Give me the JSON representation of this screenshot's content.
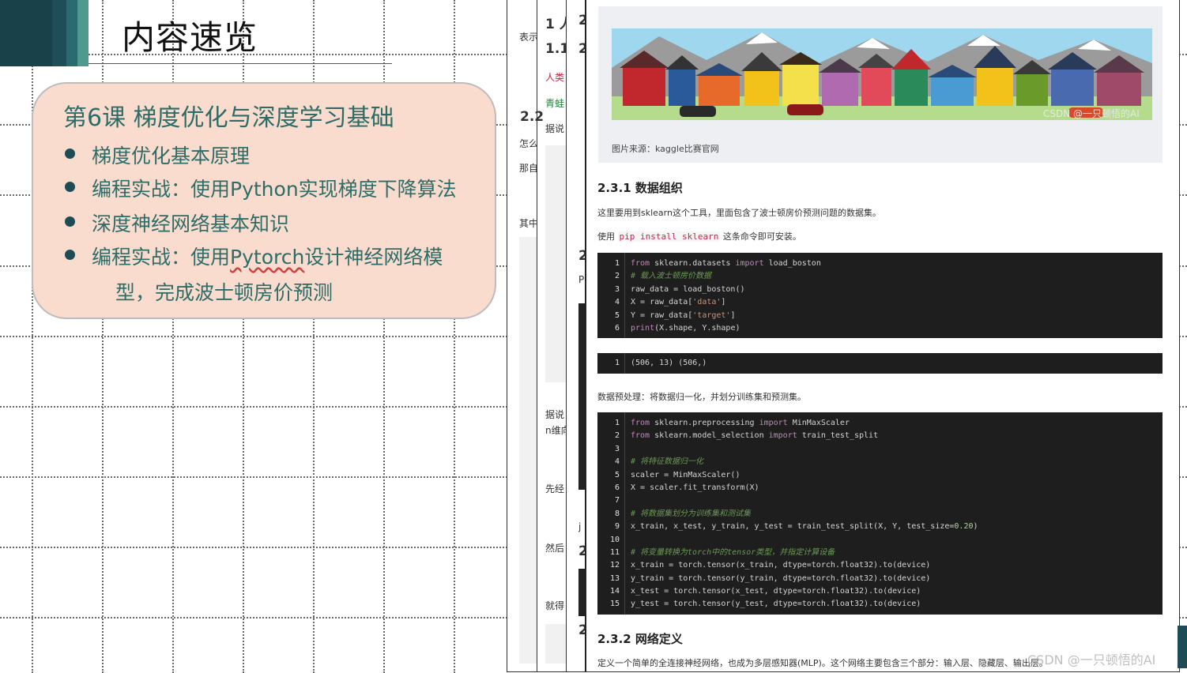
{
  "slide": {
    "title": "内容速览",
    "lesson_title": "第6课 梯度优化与深度学习基础",
    "items": [
      "梯度优化基本原理",
      "编程实战：使用Python实现梯度下降算法",
      "深度神经网络基本知识",
      "编程实战：使用Pytorch设计神经网络模",
      "型，完成波士顿房价预测"
    ],
    "pytorch_word": "Pytorch"
  },
  "bg_pages": {
    "p1": [
      "表示",
      "怎么",
      "那自",
      "其中"
    ],
    "p2": [
      "1 人",
      "1.1",
      "人类",
      "青蛙",
      "2.2",
      "据说",
      "据说",
      "n维向",
      "先经",
      "然后",
      "就得"
    ],
    "p3": [
      "2",
      "2",
      "2",
      "P",
      "2",
      "j",
      "2"
    ]
  },
  "doc": {
    "image_caption": "图片来源：kaggle比赛官网",
    "image_watermark": "CSDN @一只顿悟的AI",
    "h_data_org": "2.3.1 数据组织",
    "p_sklearn": "这里要用到sklearn这个工具，里面包含了波士顿房价预测问题的数据集。",
    "p_install_pre": "使用",
    "p_install_code": "pip install sklearn",
    "p_install_post": "这条命令即可安装。",
    "p_preprocess": "数据预处理：将数据归一化，并划分训练集和预测集。",
    "h_net_def": "2.3.2 网络定义",
    "p_net": "定义一个简单的全连接神经网络，也成为多层感知器(MLP)。这个网络主要包含三个部分：输入层、隐藏层、输出层。",
    "code1": [
      {
        "n": "1",
        "t": "from sklearn.datasets import load_boston"
      },
      {
        "n": "2",
        "t": "# 载入波士顿房价数据"
      },
      {
        "n": "3",
        "t": "raw_data = load_boston()"
      },
      {
        "n": "4",
        "t": "X = raw_data['data']"
      },
      {
        "n": "5",
        "t": "Y = raw_data['target']"
      },
      {
        "n": "6",
        "t": "print(X.shape, Y.shape)"
      }
    ],
    "output1": [
      {
        "n": "1",
        "t": "(506, 13) (506,)"
      }
    ],
    "code2": [
      {
        "n": "1",
        "t": "from sklearn.preprocessing import MinMaxScaler"
      },
      {
        "n": "2",
        "t": "from sklearn.model_selection import train_test_split"
      },
      {
        "n": "3",
        "t": ""
      },
      {
        "n": "4",
        "t": "# 将特征数据归一化"
      },
      {
        "n": "5",
        "t": "scaler = MinMaxScaler()"
      },
      {
        "n": "6",
        "t": "X = scaler.fit_transform(X)"
      },
      {
        "n": "7",
        "t": ""
      },
      {
        "n": "8",
        "t": "# 将数据集划分为训练集和测试集"
      },
      {
        "n": "9",
        "t": "x_train, x_test, y_train, y_test = train_test_split(X, Y, test_size=0.20)"
      },
      {
        "n": "10",
        "t": ""
      },
      {
        "n": "11",
        "t": "# 将变量转换为torch中的tensor类型，并指定计算设备"
      },
      {
        "n": "12",
        "t": "x_train = torch.tensor(x_train, dtype=torch.float32).to(device)"
      },
      {
        "n": "13",
        "t": "y_train = torch.tensor(y_train, dtype=torch.float32).to(device)"
      },
      {
        "n": "14",
        "t": "x_test = torch.tensor(x_test, dtype=torch.float32).to(device)"
      },
      {
        "n": "15",
        "t": "y_test = torch.tensor(y_test, dtype=torch.float32).to(device)"
      }
    ]
  },
  "footer_watermark": "CSDN @一只顿悟的AI",
  "colors": {
    "band": "#1f4e58",
    "lesson_bg": "#fadccf",
    "lesson_text": "#2d6c67",
    "code_bg": "#1e1e1e",
    "inline_code": "#c7254e"
  }
}
